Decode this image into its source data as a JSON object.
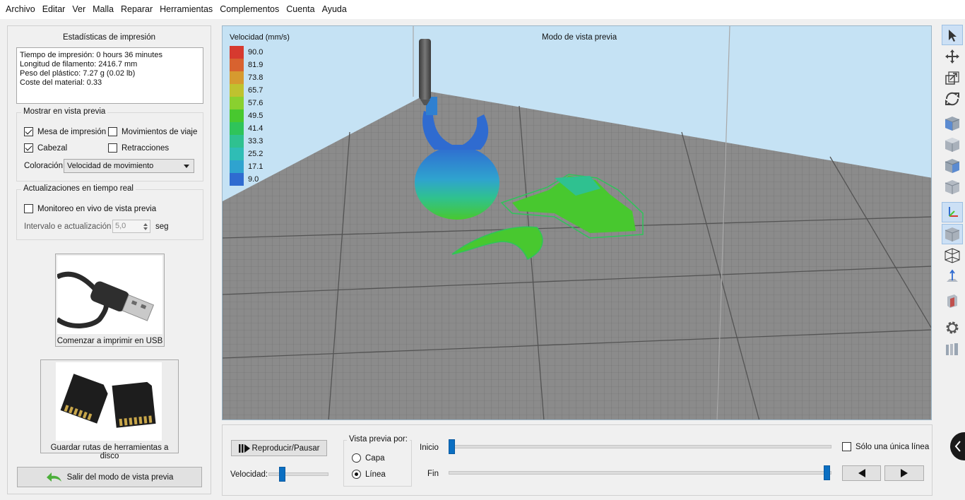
{
  "menu": [
    "Archivo",
    "Editar",
    "Ver",
    "Malla",
    "Reparar",
    "Herramientas",
    "Complementos",
    "Cuenta",
    "Ayuda"
  ],
  "stats": {
    "title": "Estadísticas de impresión",
    "lines": [
      "Tiempo de impresión: 0 hours 36 minutes",
      "Longitud de filamento: 2416.7 mm",
      "Peso del plástico: 7.27 g (0.02 lb)",
      "Coste del material: 0.33"
    ]
  },
  "show": {
    "title": "Mostrar en vista previa",
    "bed": {
      "label": "Mesa de impresión",
      "checked": true
    },
    "travel": {
      "label": "Movimientos de viaje",
      "checked": false
    },
    "head": {
      "label": "Cabezal",
      "checked": true
    },
    "retractions": {
      "label": "Retracciones",
      "checked": false
    },
    "coloring_label": "Coloración",
    "coloring_value": "Velocidad de movimiento"
  },
  "realtime": {
    "title": "Actualizaciones en tiempo real",
    "monitor": {
      "label": "Monitoreo en vivo de vista previa",
      "checked": false
    },
    "interval_label": "Intervalo e actualización",
    "interval_value": "5,0",
    "unit": "seg"
  },
  "usb_button": {
    "label": "Comenzar a imprimir en USB",
    "icon": "usb-cable-image"
  },
  "disk_button": {
    "label": "Guardar rutas de herramientas a disco",
    "icon": "sd-cards-image"
  },
  "exit_button": {
    "label": "Salir del modo de vista previa",
    "icon": "back-arrow-icon"
  },
  "viewport": {
    "title": "Modo de vista previa",
    "legend_title": "Velocidad (mm/s)",
    "legend": [
      {
        "value": "90.0",
        "color": "#d63a2f"
      },
      {
        "value": "81.9",
        "color": "#d8622f"
      },
      {
        "value": "73.8",
        "color": "#d69a2f"
      },
      {
        "value": "65.7",
        "color": "#bfc22f"
      },
      {
        "value": "57.6",
        "color": "#8ad02f"
      },
      {
        "value": "49.5",
        "color": "#48c82f"
      },
      {
        "value": "41.4",
        "color": "#2fc45a"
      },
      {
        "value": "33.3",
        "color": "#2fc190"
      },
      {
        "value": "25.2",
        "color": "#2fbdb5"
      },
      {
        "value": "17.1",
        "color": "#2fa3cf"
      },
      {
        "value": "9.0",
        "color": "#2f6bd0"
      }
    ]
  },
  "bottom": {
    "play_label": "Reproducir/Pausar",
    "speed_label": "Velocidad:",
    "preview_by_label": "Vista previa por:",
    "layer": {
      "label": "Capa",
      "selected": false
    },
    "line": {
      "label": "Línea",
      "selected": true
    },
    "start_label": "Inicio",
    "end_label": "Fin",
    "single_line": {
      "label": "Sólo una única línea",
      "checked": false
    }
  },
  "toolbar_icons": [
    "select-arrow-icon",
    "move-icon",
    "scale-icon",
    "rotate-icon",
    "view-front-icon",
    "view-top-icon",
    "view-side-icon",
    "view-iso-icon",
    "axes-icon",
    "solid-view-icon",
    "wireframe-view-icon",
    "normals-icon",
    "section-cut-icon",
    "settings-gear-icon",
    "supports-icon"
  ]
}
